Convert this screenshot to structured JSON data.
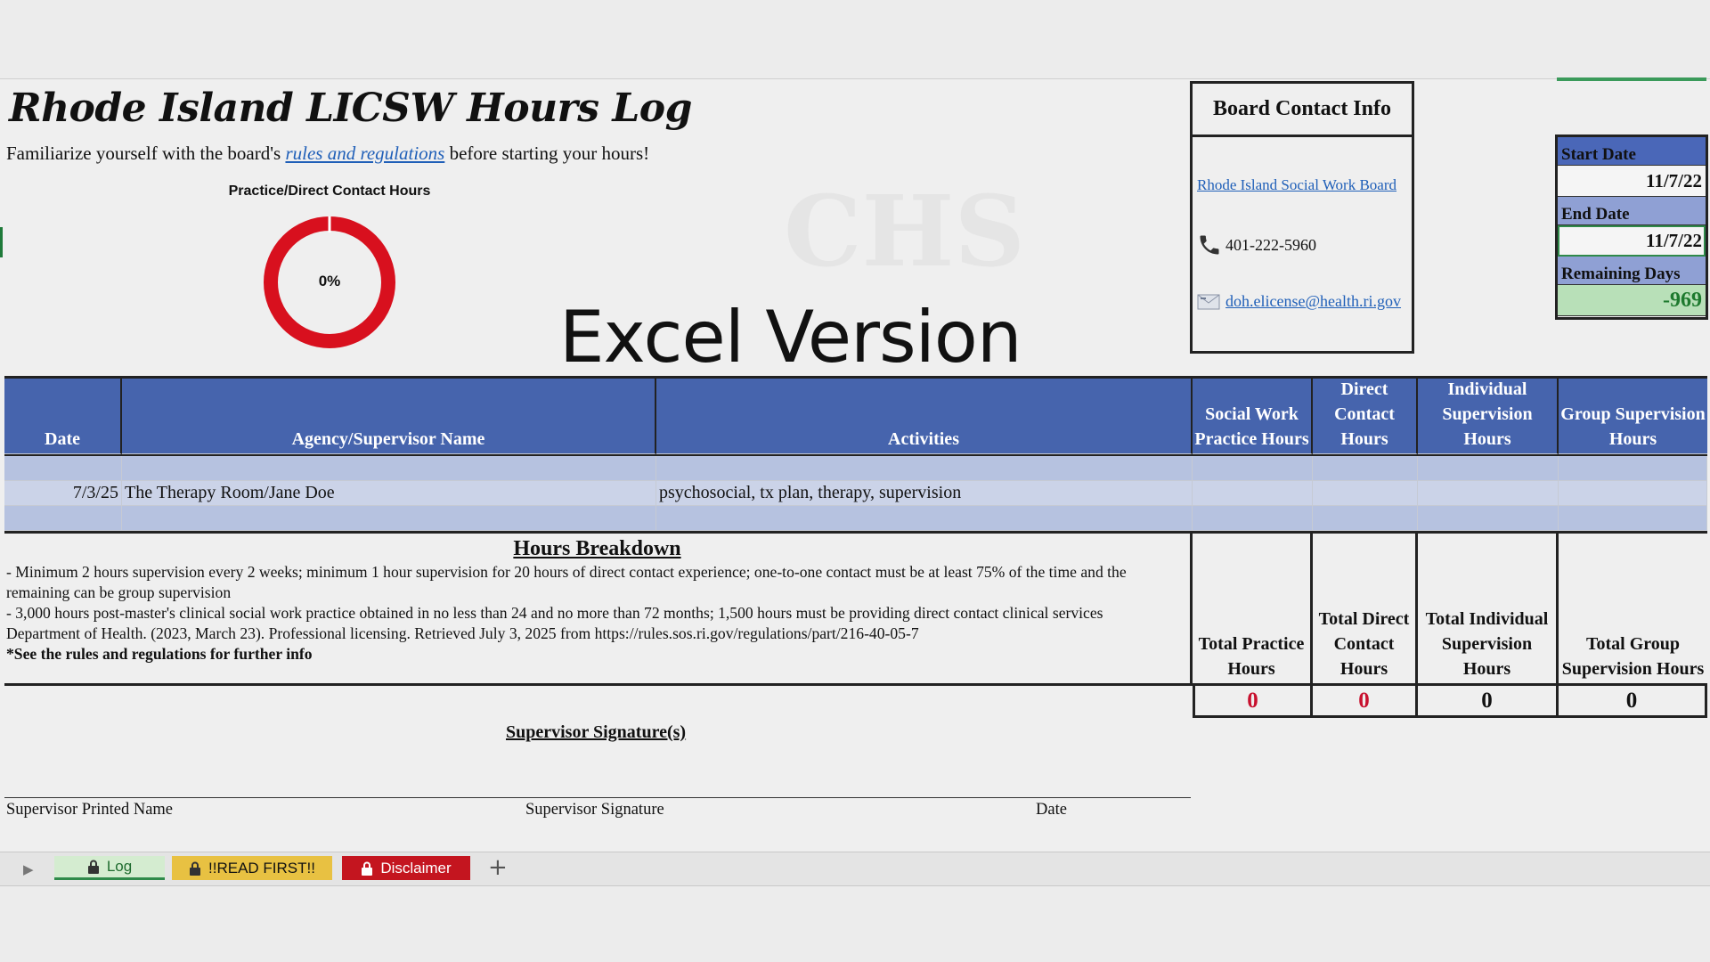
{
  "header": {
    "title": "Rhode Island LICSW Hours Log",
    "subtitle_before": "Familiarize yourself with the board's ",
    "subtitle_link": "rules and regulations",
    "subtitle_after": " before starting your hours!",
    "banner": "Excel Version"
  },
  "progress": {
    "title": "Practice/Direct Contact Hours",
    "percent_label": "0%",
    "fraction": 0,
    "ring_color": "#d8101e"
  },
  "board": {
    "title": "Board Contact Info",
    "link": "Rhode Island Social Work Board",
    "phone": "401-222-5960",
    "email": "doh.elicense@health.ri.gov"
  },
  "dates": {
    "start_label": "Start Date",
    "start_value": "11/7/22",
    "end_label": "End Date",
    "end_value": "11/7/22",
    "remaining_label": "Remaining Days",
    "remaining_value": "-969"
  },
  "table": {
    "columns": [
      "Date",
      "Agency/Supervisor Name",
      "Activities",
      "Social Work Practice Hours",
      "Direct Contact Hours",
      "Individual Supervision Hours",
      "Group Supervision Hours"
    ],
    "rows": [
      [
        "",
        "",
        "",
        "",
        "",
        "",
        ""
      ],
      [
        "7/3/25",
        "The Therapy Room/Jane Doe",
        "psychosocial, tx plan, therapy, supervision",
        "",
        "",
        "",
        ""
      ],
      [
        "",
        "",
        "",
        "",
        "",
        "",
        ""
      ]
    ]
  },
  "breakdown": {
    "title": "Hours Breakdown",
    "lines": [
      "- Minimum 2 hours supervision every 2 weeks; minimum 1 hour supervision for 20 hours of direct contact experience; one-to-one contact must be at least 75% of the time and the remaining can be group supervision",
      "- 3,000 hours post-master's clinical social work practice obtained in no less than 24 and no more than 72 months; 1,500 hours must be providing direct contact clinical services",
      "Department of Health. (2023, March 23). Professional licensing. Retrieved July 3, 2025 from https://rules.sos.ri.gov/regulations/part/216-40-05-7"
    ],
    "note": "*See the rules and regulations for further info"
  },
  "totals": {
    "labels": [
      "Total Practice Hours",
      "Total Direct Contact Hours",
      "Total Individual Supervision Hours",
      "Total Group Supervision Hours"
    ],
    "values": [
      "0",
      "0",
      "0",
      "0"
    ]
  },
  "signature": {
    "title": "Supervisor Signature(s)",
    "printed_name": "Supervisor Printed Name",
    "signature": "Supervisor Signature",
    "date": "Date"
  },
  "tabs": {
    "log": "Log",
    "read_first": "!!READ FIRST!!",
    "disclaimer": "Disclaimer",
    "add": "+"
  },
  "colors": {
    "header_blue": "#4664ad",
    "remaining_green": "#b8e0b8",
    "total_red": "#c8102e"
  }
}
